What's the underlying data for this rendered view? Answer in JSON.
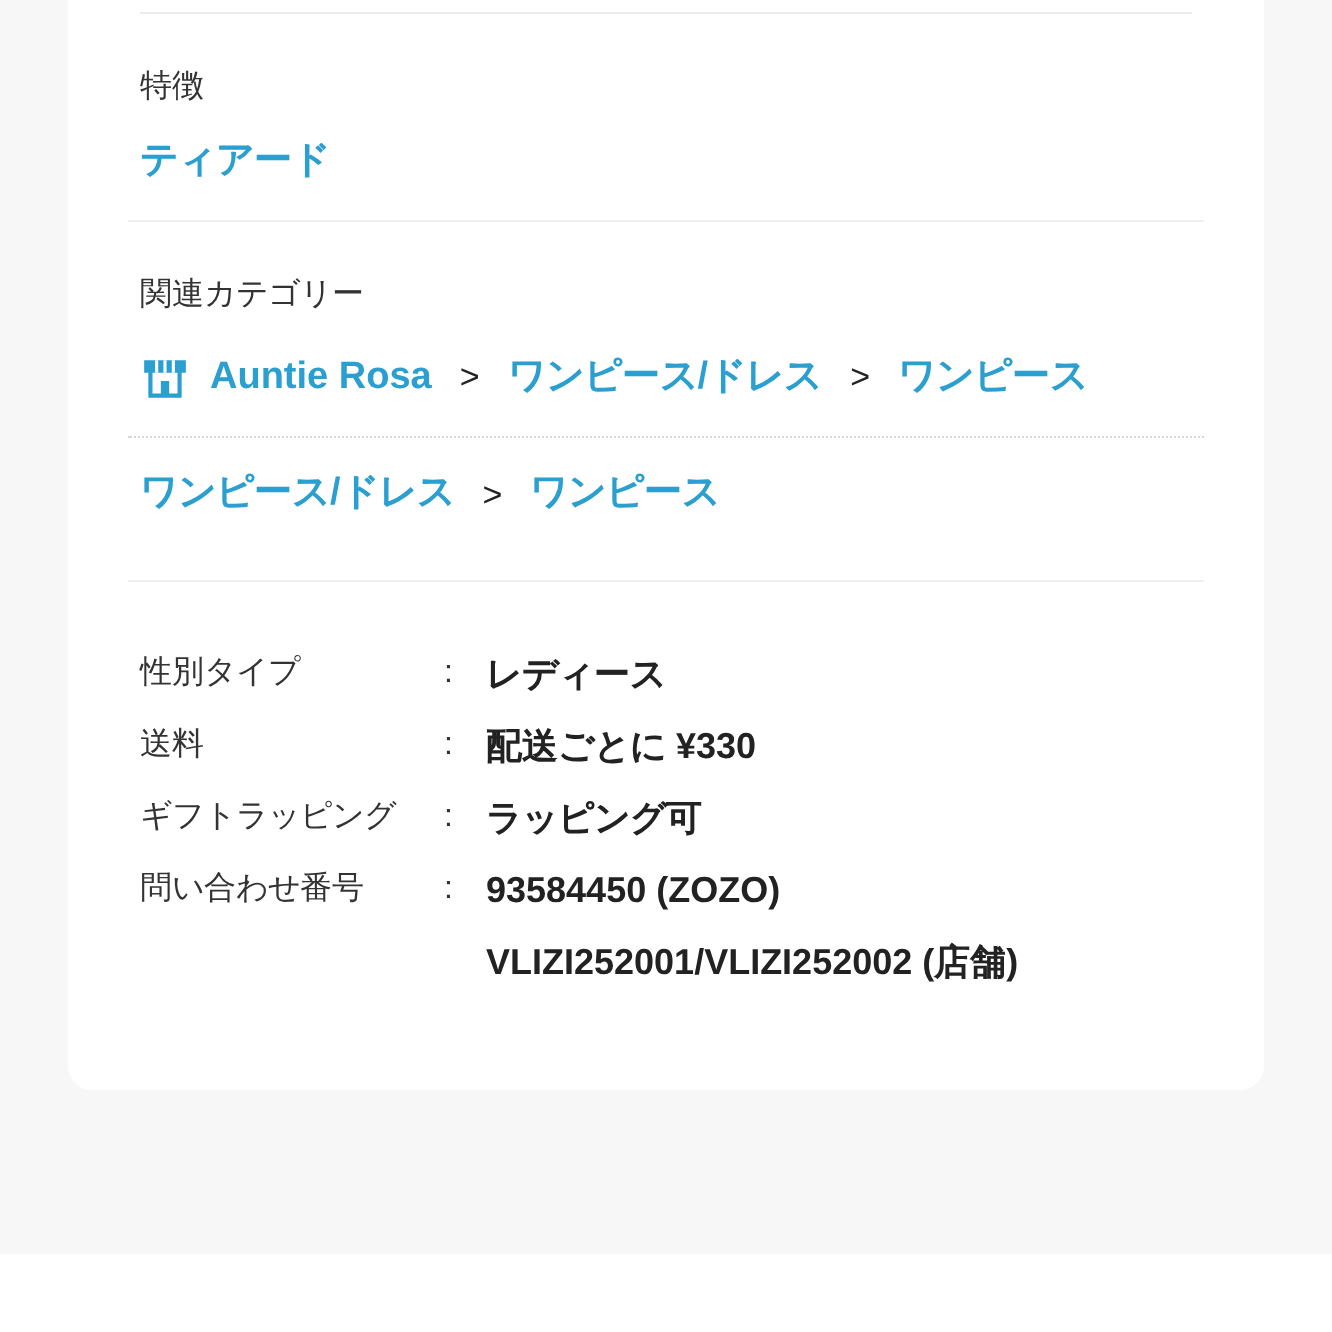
{
  "features": {
    "label": "特徴",
    "value": "ティアード"
  },
  "related_categories": {
    "label": "関連カテゴリー",
    "paths": [
      [
        {
          "kind": "shop",
          "text": "Auntie Rosa"
        },
        {
          "kind": "separator",
          "text": ">"
        },
        {
          "kind": "link",
          "text": "ワンピース/ドレス"
        },
        {
          "kind": "separator",
          "text": ">"
        },
        {
          "kind": "link",
          "text": "ワンピース"
        }
      ],
      [
        {
          "kind": "link",
          "text": "ワンピース/ドレス"
        },
        {
          "kind": "separator",
          "text": ">"
        },
        {
          "kind": "link",
          "text": "ワンピース"
        }
      ]
    ]
  },
  "specs": [
    {
      "label": "性別タイプ",
      "colon": ":",
      "values": [
        "レディース"
      ]
    },
    {
      "label": "送料",
      "colon": ":",
      "values": [
        "配送ごとに ¥330"
      ]
    },
    {
      "label": "ギフトラッピング",
      "colon": ":",
      "values": [
        "ラッピング可"
      ]
    },
    {
      "label": "問い合わせ番号",
      "colon": ":",
      "values": [
        "93584450 (ZOZO)",
        "VLIZI252001/VLIZI252002 (店舗)"
      ]
    }
  ]
}
